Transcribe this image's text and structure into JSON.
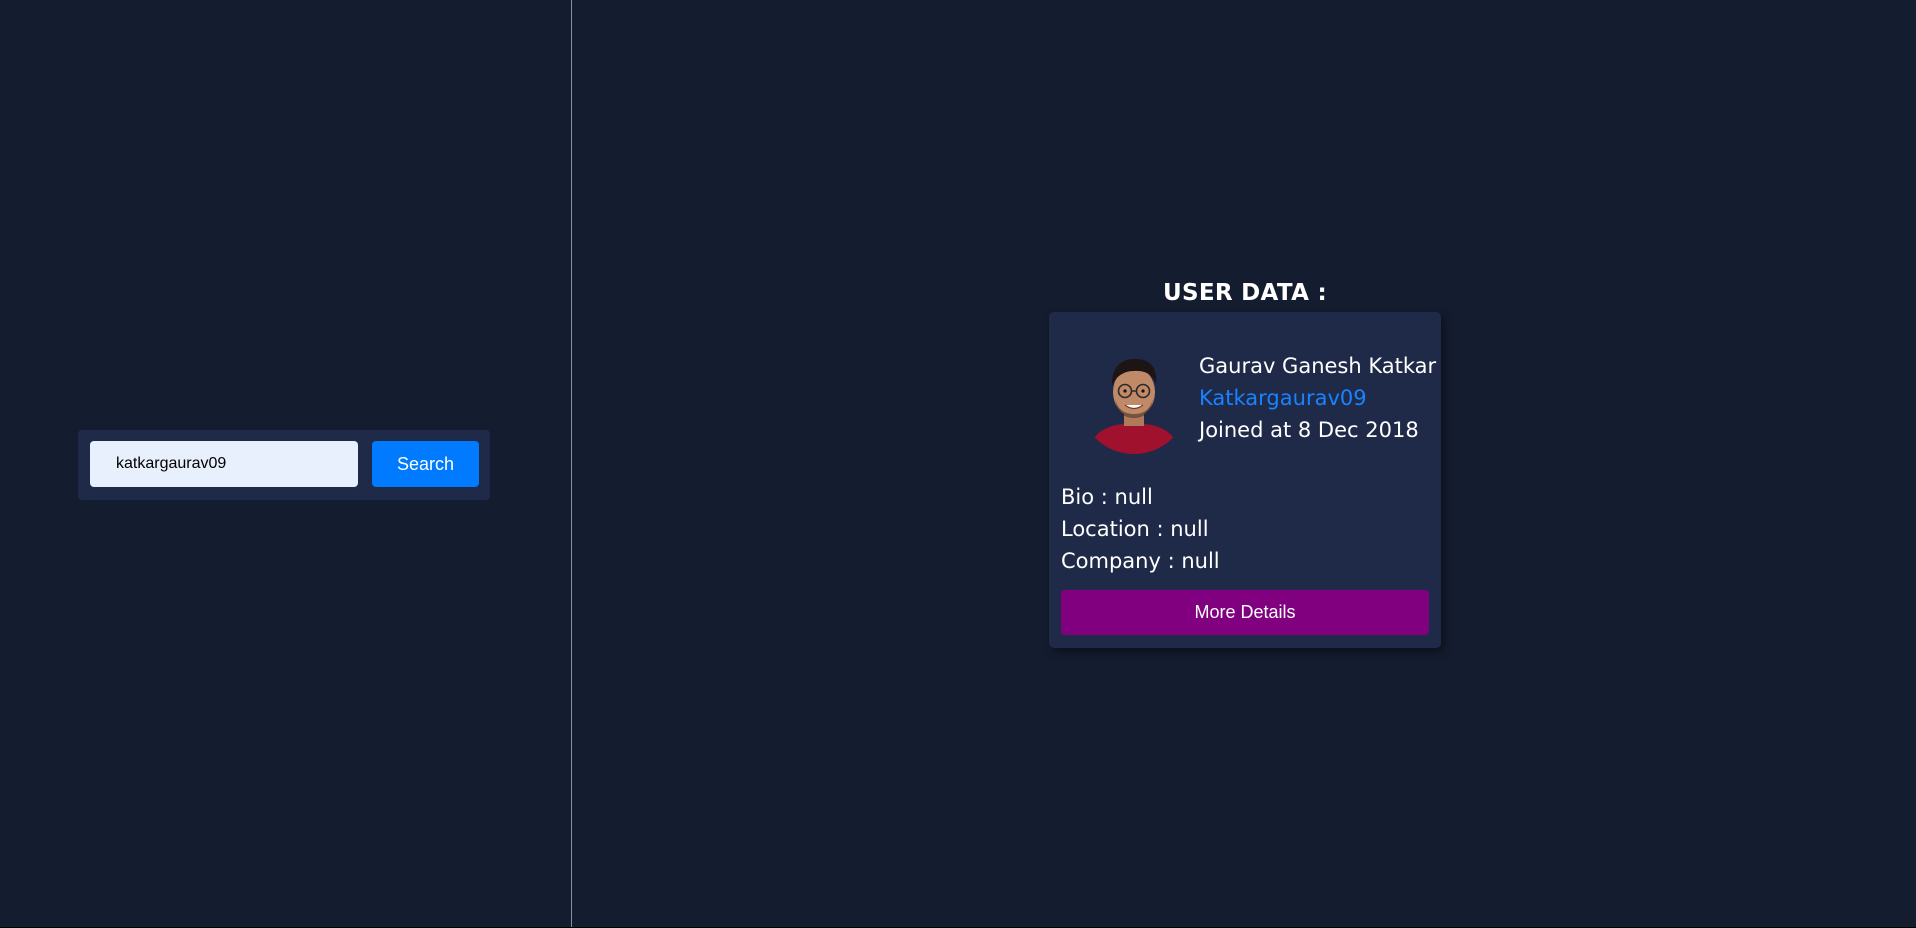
{
  "search": {
    "input_value": "katkargaurav09",
    "button_label": "Search"
  },
  "user_section": {
    "heading": "USER DATA :"
  },
  "user": {
    "name": "Gaurav Ganesh Katkar",
    "login": "Katkargaurav09",
    "joined": "Joined at 8 Dec 2018",
    "bio": "Bio : null",
    "location": "Location : null",
    "company": "Company : null",
    "more_button_label": "More Details"
  },
  "colors": {
    "background": "#141c2f",
    "panel": "#1f2a48",
    "search_button": "#007bff",
    "link": "#1a82ff",
    "more_button": "#800080"
  },
  "icons": {
    "avatar": "user-avatar-photo"
  }
}
